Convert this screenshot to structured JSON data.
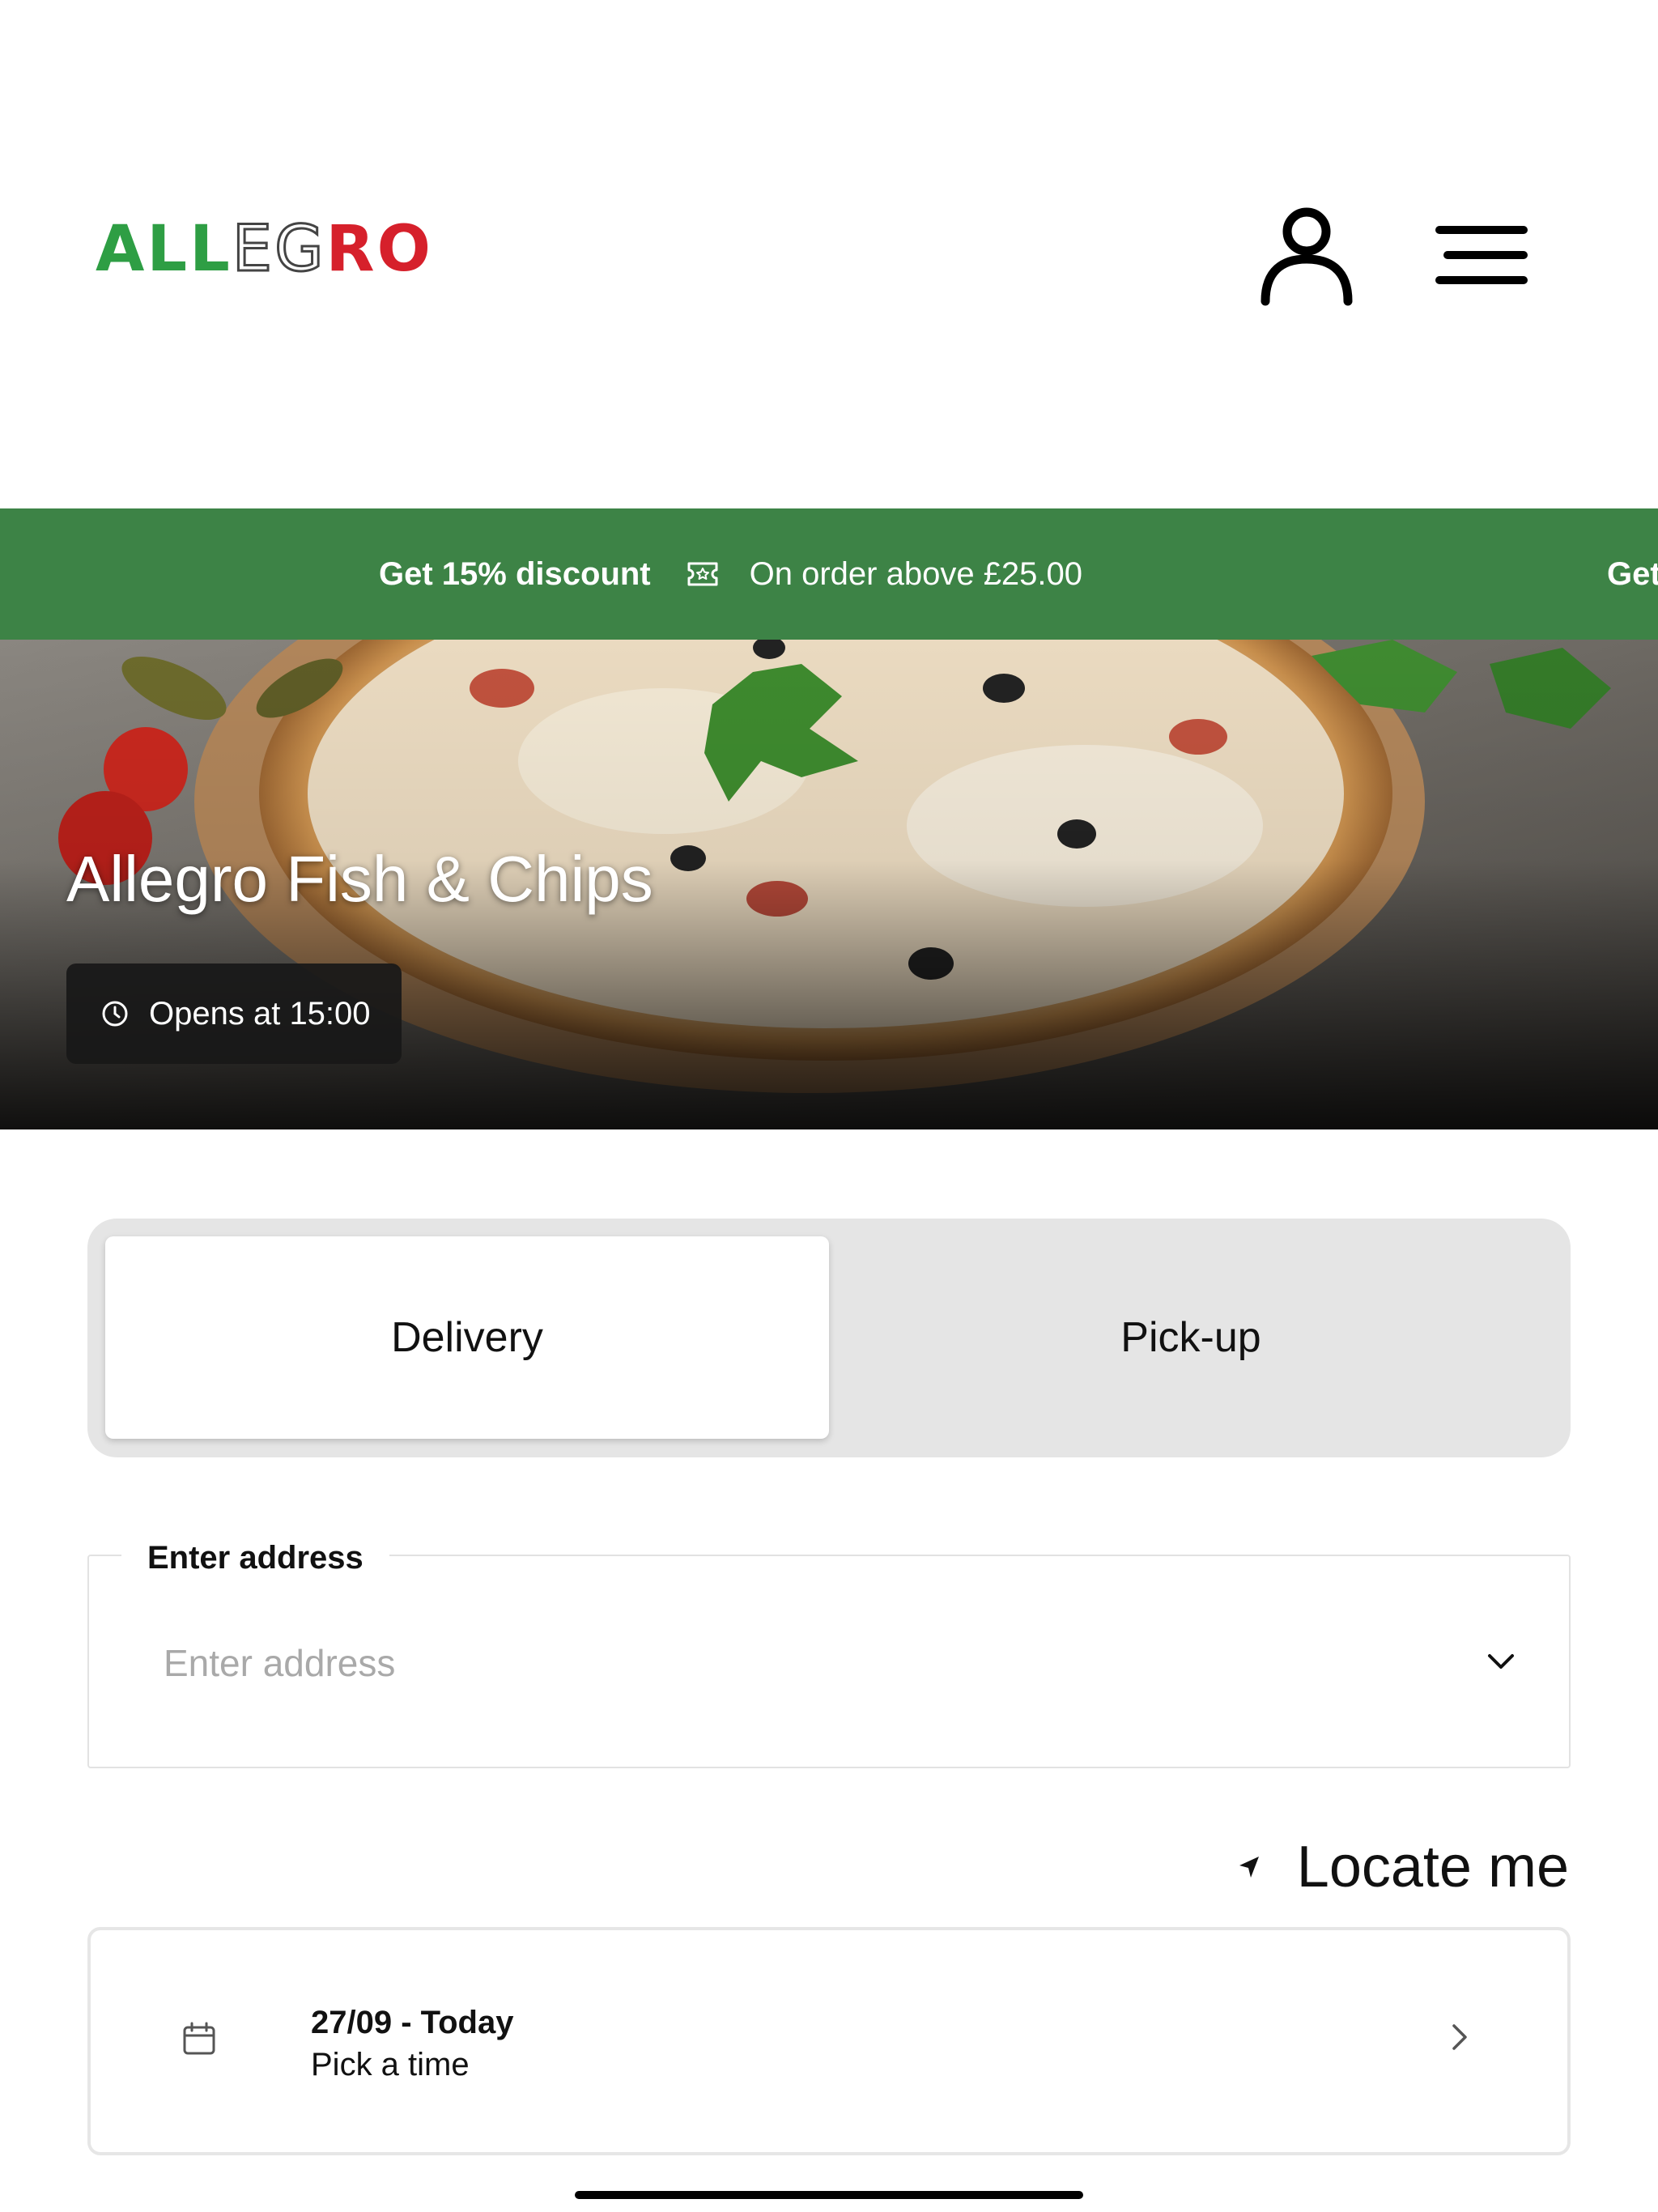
{
  "header": {
    "logo_text": "ALLEGRO",
    "icons": {
      "user": "user-icon",
      "menu": "hamburger-menu-icon"
    }
  },
  "promo": {
    "items": [
      {
        "headline": "Get 15% discount",
        "detail": "On order above £25.00"
      },
      {
        "headline": "Get"
      }
    ],
    "icon": "ticket-icon",
    "background": "#3d8346"
  },
  "restaurant": {
    "name": "Allegro Fish & Chips",
    "hours": "Opens at 15:00",
    "hours_icon": "clock-icon"
  },
  "order_type": {
    "options": [
      "Delivery",
      "Pick-up"
    ],
    "selected": "Delivery"
  },
  "address": {
    "label": "Enter address",
    "placeholder": "Enter address",
    "value": ""
  },
  "locate": {
    "label": "Locate me",
    "icon": "location-arrow-icon"
  },
  "schedule": {
    "date": "27/09 - Today",
    "time_prompt": "Pick a time",
    "icon": "calendar-icon"
  },
  "colors": {
    "brand_green": "#3d8346",
    "logo_green": "#2e9e44",
    "logo_red": "#d6202b"
  }
}
